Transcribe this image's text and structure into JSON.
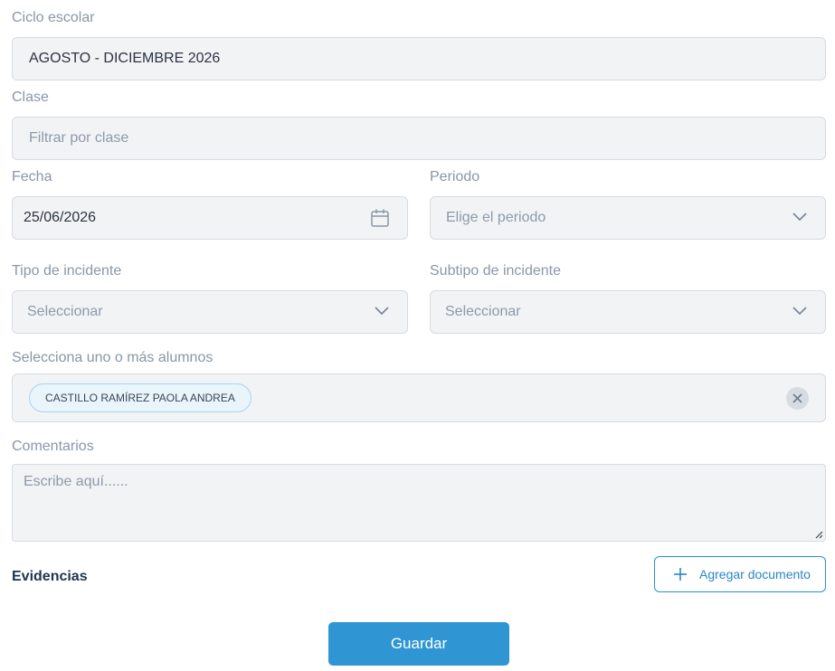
{
  "form": {
    "ciclo": {
      "label": "Ciclo escolar",
      "value": "AGOSTO - DICIEMBRE 2026"
    },
    "clase": {
      "label": "Clase",
      "placeholder": "Filtrar por clase"
    },
    "fecha": {
      "label": "Fecha",
      "value": "25/06/2026",
      "icon": "calendar-icon"
    },
    "periodo": {
      "label": "Periodo",
      "placeholder": "Elige el periodo",
      "icon": "chevron-down-icon"
    },
    "tipo": {
      "label": "Tipo de incidente",
      "placeholder": "Seleccionar"
    },
    "subtipo": {
      "label": "Subtipo de incidente",
      "placeholder": "Seleccionar"
    },
    "alumnos": {
      "label": "Selecciona uno o más alumnos",
      "chips": [
        "CASTILLO RAMÍREZ PAOLA ANDREA"
      ]
    },
    "comentarios": {
      "label": "Comentarios",
      "placeholder": "Escribe aquí......"
    },
    "evidencias": {
      "label": "Evidencias",
      "add_button": "Agregar documento"
    },
    "save_button": "Guardar"
  },
  "colors": {
    "accent": "#2f95d3",
    "field_bg": "#f2f3f5",
    "heading": "#1f3550"
  }
}
